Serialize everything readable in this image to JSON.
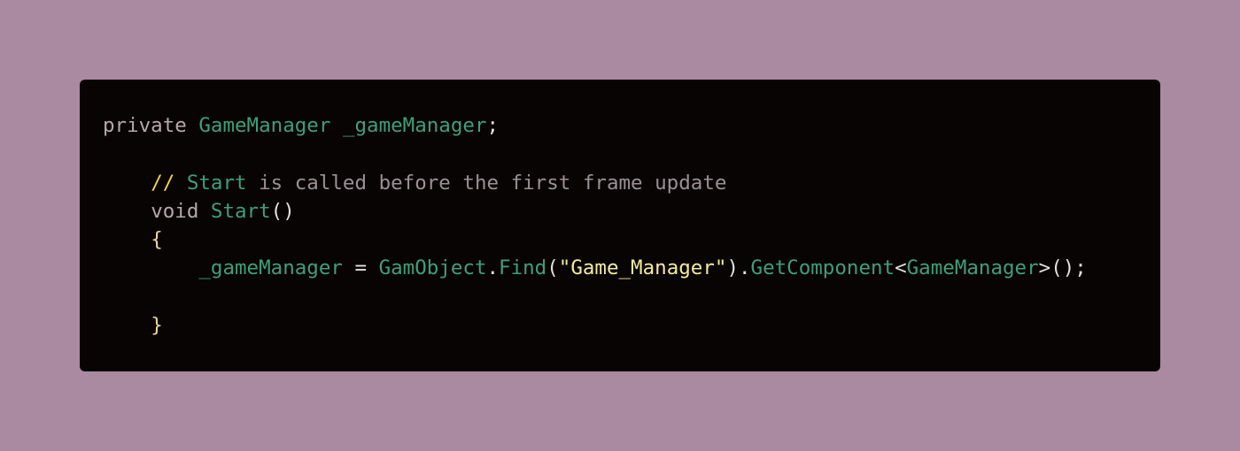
{
  "code": {
    "lines": [
      [
        {
          "t": "private",
          "c": "kw"
        },
        {
          "t": " ",
          "c": "plain"
        },
        {
          "t": "GameManager",
          "c": "type"
        },
        {
          "t": " ",
          "c": "plain"
        },
        {
          "t": "_gameManager",
          "c": "ident"
        },
        {
          "t": ";",
          "c": "punct"
        }
      ],
      [],
      [
        {
          "t": "    ",
          "c": "plain"
        },
        {
          "t": "//",
          "c": "cslash"
        },
        {
          "t": " ",
          "c": "plain"
        },
        {
          "t": "Start",
          "c": "cword"
        },
        {
          "t": " is called before the first frame update",
          "c": "ctext"
        }
      ],
      [
        {
          "t": "    ",
          "c": "plain"
        },
        {
          "t": "void",
          "c": "kw"
        },
        {
          "t": " ",
          "c": "plain"
        },
        {
          "t": "Start",
          "c": "ident"
        },
        {
          "t": "()",
          "c": "punct"
        }
      ],
      [
        {
          "t": "    ",
          "c": "plain"
        },
        {
          "t": "{",
          "c": "brace"
        }
      ],
      [
        {
          "t": "        ",
          "c": "plain"
        },
        {
          "t": "_gameManager",
          "c": "ident"
        },
        {
          "t": " = ",
          "c": "punct"
        },
        {
          "t": "GamObject",
          "c": "type"
        },
        {
          "t": ".",
          "c": "punct"
        },
        {
          "t": "Find",
          "c": "ident"
        },
        {
          "t": "(",
          "c": "punct"
        },
        {
          "t": "\"Game_Manager\"",
          "c": "str"
        },
        {
          "t": ").",
          "c": "punct"
        },
        {
          "t": "GetComponent",
          "c": "ident"
        },
        {
          "t": "<",
          "c": "punct"
        },
        {
          "t": "GameManager",
          "c": "type"
        },
        {
          "t": ">();",
          "c": "punct"
        }
      ],
      [],
      [
        {
          "t": "    ",
          "c": "plain"
        },
        {
          "t": "}",
          "c": "brace"
        }
      ]
    ]
  }
}
